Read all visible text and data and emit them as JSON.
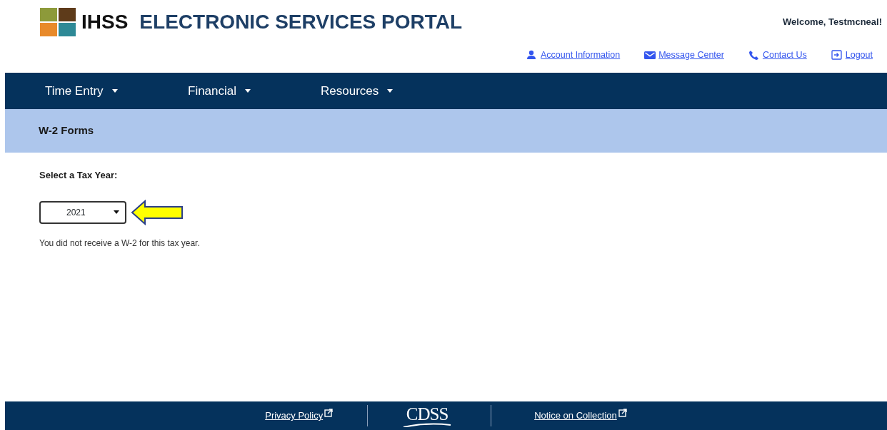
{
  "header": {
    "logo_text": "IHSS",
    "portal_title": "ELECTRONIC SERVICES PORTAL",
    "welcome": "Welcome, Testmcneal!",
    "links": [
      {
        "kind": "person",
        "label": "Account Information"
      },
      {
        "kind": "mail",
        "label": " Message Center"
      },
      {
        "kind": "phone",
        "label": "Contact Us"
      },
      {
        "kind": "logout",
        "label": "Logout"
      }
    ]
  },
  "nav": [
    {
      "label": "Time Entry"
    },
    {
      "label": "Financial"
    },
    {
      "label": "Resources"
    }
  ],
  "page_title": "W-2 Forms",
  "form": {
    "label": "Select a Tax Year:",
    "value": "2021",
    "message": "You did not receive a W-2 for this tax year."
  },
  "footer": {
    "links": [
      "Privacy Policy",
      "Notice on Collection"
    ],
    "logo_text": "CDSS"
  }
}
